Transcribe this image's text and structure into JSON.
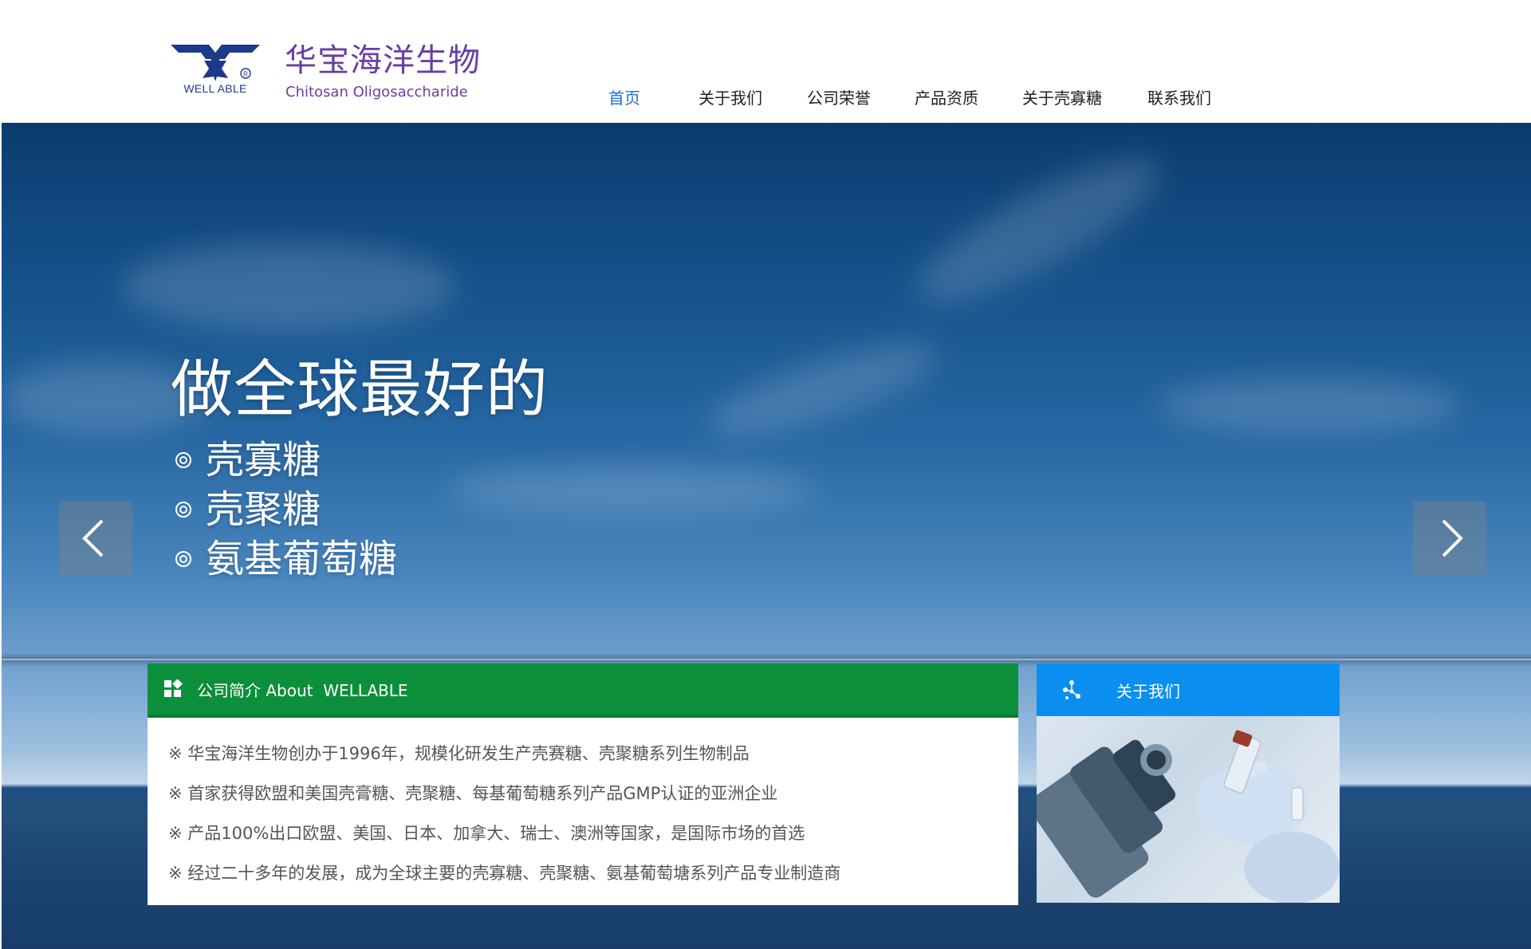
{
  "header": {
    "logo_text": "WELL ABLE",
    "brand_cn": "华宝海洋生物",
    "brand_en": "Chitosan Oligosaccharide"
  },
  "nav": {
    "items": [
      {
        "label": "首页",
        "active": true
      },
      {
        "label": "关于我们",
        "active": false
      },
      {
        "label": "公司荣誉",
        "active": false
      },
      {
        "label": "产品资质",
        "active": false
      },
      {
        "label": "关于壳寡糖",
        "active": false
      },
      {
        "label": "联系我们",
        "active": false
      }
    ]
  },
  "hero": {
    "title": "做全球最好的",
    "items": [
      "壳寡糖",
      "壳聚糖",
      "氨基葡萄糖"
    ],
    "prev_icon": "chevron-left-icon",
    "next_icon": "chevron-right-icon"
  },
  "about": {
    "heading": "公司简介 About  WELLABLE",
    "lines": [
      "※ 华宝海洋生物创办于1996年，规模化研发生产壳赛糖、壳聚糖系列生物制品",
      "※ 首家获得欧盟和美国壳膏糖、壳聚糖、每基葡萄糖系列产品GMP认证的亚洲企业",
      "※ 产品100%出口欧盟、美国、日本、加拿大、瑞士、澳洲等国家，是国际市场的首选",
      "※ 经过二十多年的发展，成为全球主要的壳寡糖、壳聚糖、氨基葡萄塘系列产品专业制造商"
    ]
  },
  "side_card": {
    "heading": "关于我们"
  },
  "colors": {
    "brand_purple": "#6a3ea1",
    "nav_active": "#1f6fd1",
    "about_green": "#0c8f3a",
    "side_blue": "#0a8ff0"
  }
}
